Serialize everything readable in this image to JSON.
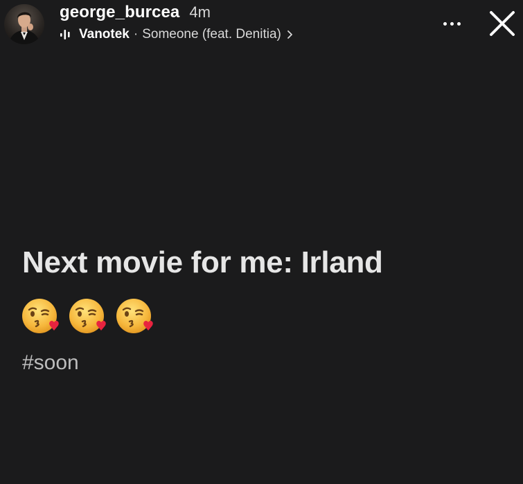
{
  "header": {
    "username": "george_burcea",
    "time": "4m",
    "avatar_icon": "profile-photo",
    "music": {
      "icon": "music-bars-icon",
      "artist": "Vanotek",
      "separator": "·",
      "song": "Someone (feat. Denitia)",
      "chevron_icon": "chevron-right-icon"
    },
    "more_icon": "more-dots-icon",
    "close_icon": "close-icon"
  },
  "story": {
    "headline": "Next movie for me: Irland",
    "emojis": [
      "face-blowing-a-kiss",
      "face-blowing-a-kiss",
      "face-blowing-a-kiss"
    ],
    "hashtag": "#soon"
  },
  "colors": {
    "background": "#1b1b1c",
    "headline": "#e6e6e6",
    "hashtag": "#bdbdbd"
  }
}
